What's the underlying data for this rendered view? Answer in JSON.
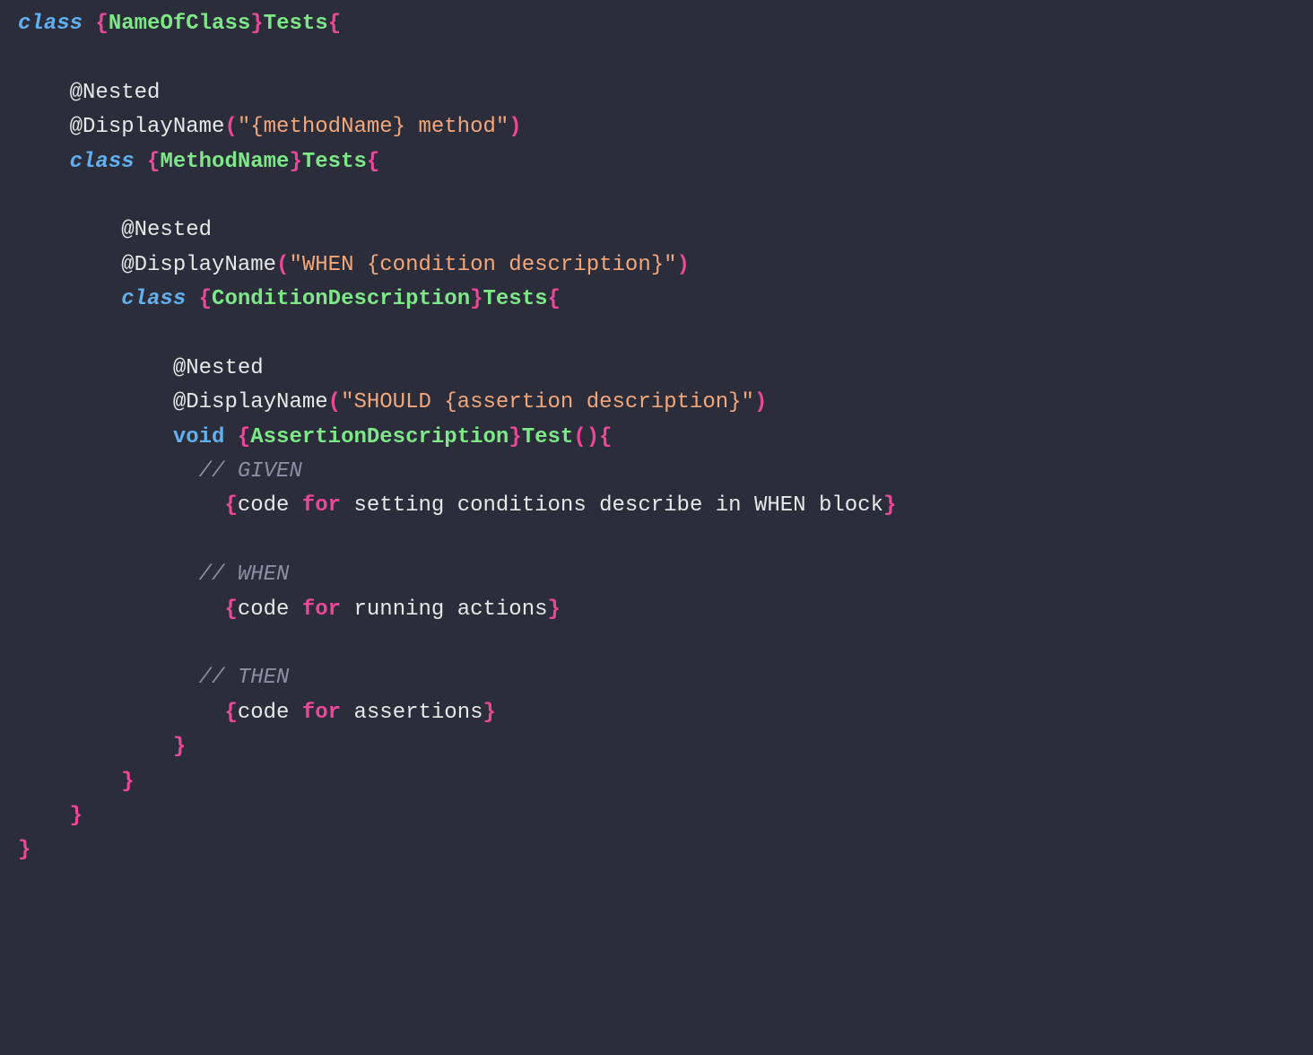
{
  "code": {
    "kw_class": "class",
    "kw_void": "void",
    "kw_for": "for",
    "brace_open": "{",
    "brace_close": "}",
    "paren_open": "(",
    "paren_close": ")",
    "paren_pair": "()",
    "ann_nested": "@Nested",
    "ann_displayname": "@DisplayName",
    "outer_class_pre": "{",
    "outer_class_name": "NameOfClass",
    "outer_class_post": "}",
    "tests_suffix": "Tests",
    "test_suffix": "Test",
    "dn_method": "\"{methodName} method\"",
    "method_class_pre": "{",
    "method_class_name": "MethodName",
    "method_class_post": "}",
    "dn_when": "\"WHEN {condition description}\"",
    "cond_class_pre": "{",
    "cond_class_name": "ConditionDescription",
    "cond_class_post": "}",
    "dn_should": "\"SHOULD {assertion description}\"",
    "assert_method_pre": "{",
    "assert_method_name": "AssertionDescription",
    "assert_method_post": "}",
    "comment_given": "// GIVEN",
    "given_text_a": "code ",
    "given_text_b": " setting conditions describe in WHEN block",
    "comment_when": "// WHEN",
    "when_text_a": "code ",
    "when_text_b": " running actions",
    "comment_then": "// THEN",
    "then_text_a": "code ",
    "then_text_b": " assertions"
  }
}
